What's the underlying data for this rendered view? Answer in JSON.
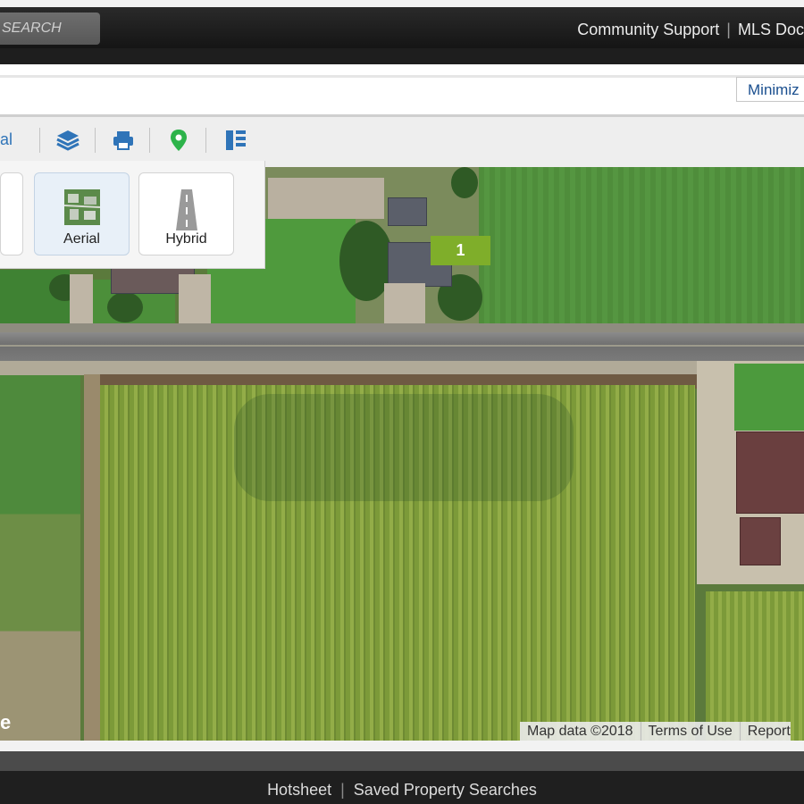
{
  "header": {
    "search_label": "SEARCH",
    "links": [
      "Community Support",
      "MLS Doc"
    ]
  },
  "panel": {
    "minimize_label": "Minimiz"
  },
  "toolbar": {
    "partial_label": "al",
    "icons": [
      "layers-icon",
      "print-icon",
      "map-pin-icon",
      "columns-icon"
    ]
  },
  "map_types": {
    "options": [
      "Aerial",
      "Hybrid"
    ],
    "selected": "Aerial"
  },
  "map": {
    "marker_label": "1",
    "attribution": [
      "Map data ©2018",
      "Terms of Use",
      "Report"
    ],
    "logo_fragment": "e"
  },
  "footer": {
    "links": [
      "Hotsheet",
      "Saved Property Searches"
    ]
  },
  "colors": {
    "marker": "#7fae2a",
    "link_blue": "#2f74b8",
    "icon_green": "#2db34a"
  }
}
